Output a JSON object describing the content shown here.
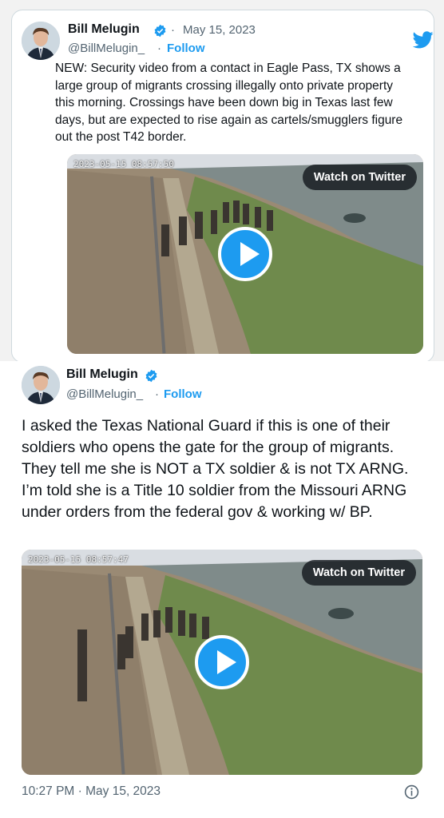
{
  "colors": {
    "accent": "#1d9bf0",
    "muted": "#536471",
    "text": "#0f1419"
  },
  "quoted_tweet": {
    "author_name": "Bill Melugin",
    "date": "May 15, 2023",
    "separator": "·",
    "handle": "@BillMelugin_",
    "follow_label": "Follow",
    "text": "NEW: Security video from a contact in Eagle Pass, TX shows a large group of migrants crossing illegally onto private property this morning. Crossings have been down big in Texas last few days, but are expected to rise again as cartels/smugglers figure out the post T42 border.",
    "video": {
      "camera_timestamp": "2023-05-15 08:57:50",
      "watch_label": "Watch on Twitter",
      "icon": "play-icon"
    }
  },
  "main_tweet": {
    "author_name": "Bill Melugin",
    "handle": "@BillMelugin_",
    "separator": "·",
    "follow_label": "Follow",
    "text": "I asked the Texas National Guard if this is one of their soldiers who opens the gate for the group of migrants. They tell me she is NOT a TX soldier & is not TX ARNG. I’m told she is a Title 10 soldier from the Missouri ARNG under orders from the federal gov & working w/ BP.",
    "video": {
      "camera_timestamp": "2023-05-15 08:57:47",
      "watch_label": "Watch on Twitter",
      "icon": "play-icon"
    },
    "timestamp": "10:27 PM · May 15, 2023"
  },
  "icons": {
    "brand": "twitter-bird-icon",
    "verified": "verified-badge-icon",
    "info": "info-icon"
  }
}
